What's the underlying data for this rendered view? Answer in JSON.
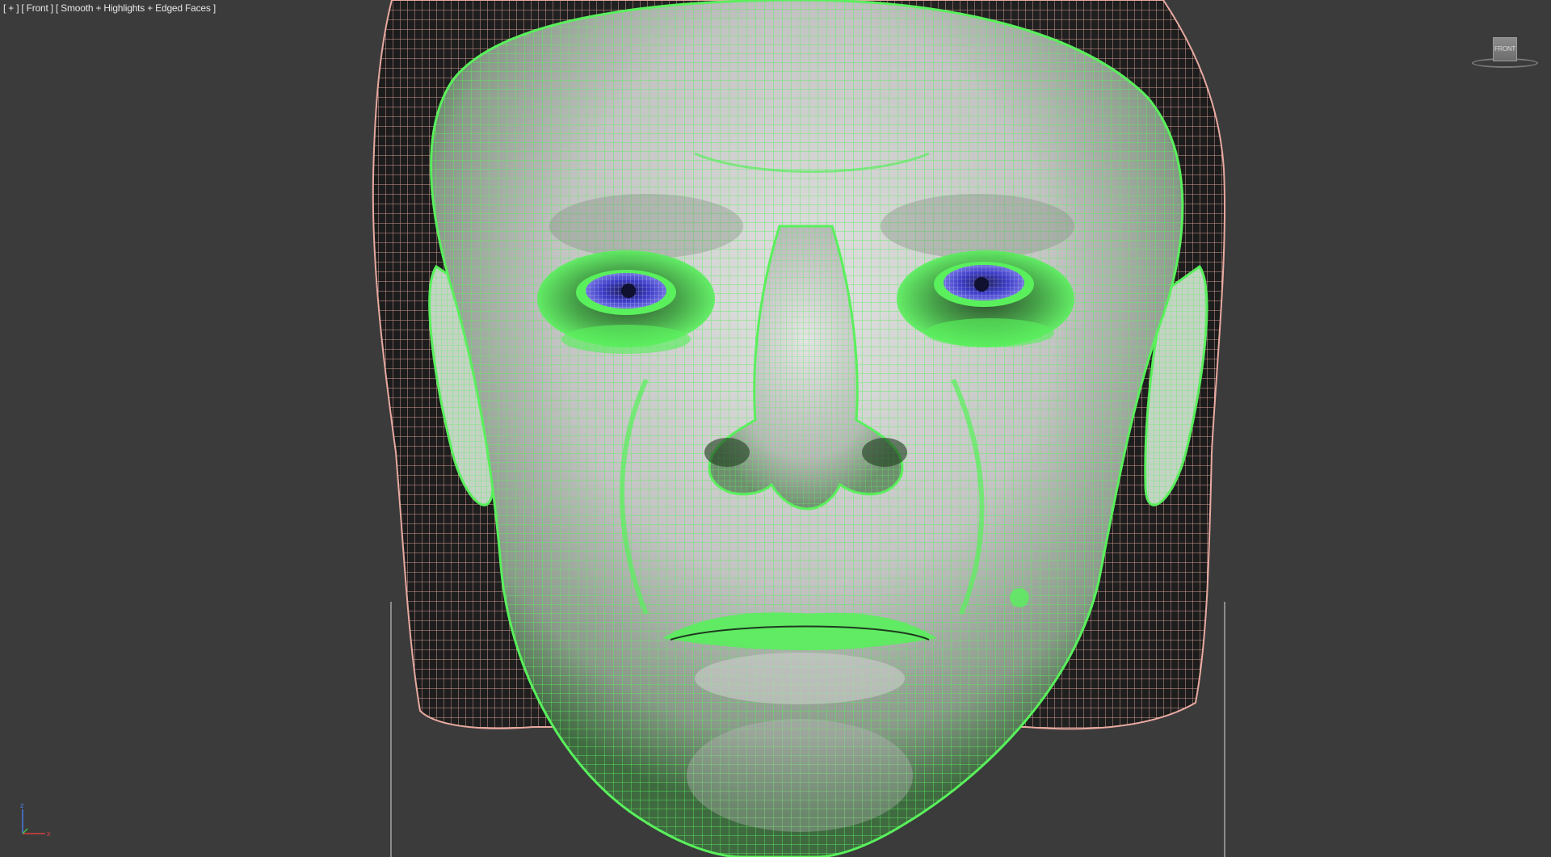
{
  "viewport": {
    "label": {
      "menu": "[ + ]",
      "view": "[ Front ]",
      "shading": "[ Smooth + Highlights + Edged Faces ]"
    },
    "viewcube": {
      "face_label": "FRONT"
    },
    "axis": {
      "z_label": "z",
      "x_label": "x"
    }
  },
  "colors": {
    "background": "#3b3b3b",
    "face_wire": "#59f05c",
    "hair_wire": "#e8aaa0",
    "eye_wire": "#3c3cc8",
    "skin_base": "#d0d0d0"
  }
}
